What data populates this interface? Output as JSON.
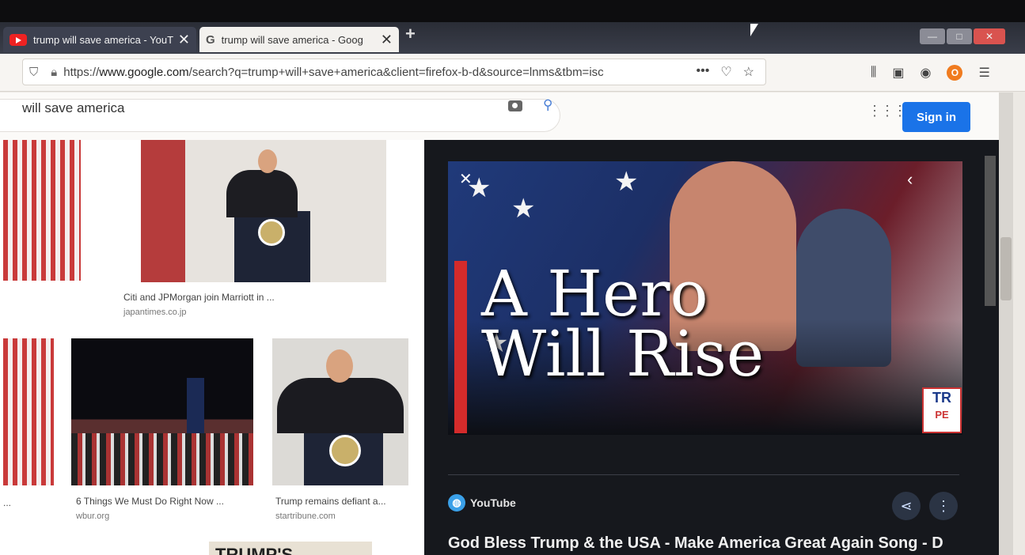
{
  "browser": {
    "tabs": [
      {
        "title": "trump will save america - YouT",
        "close": "✕"
      },
      {
        "title": "trump will save america - Goog",
        "close": "✕"
      }
    ],
    "new_tab": "+",
    "url_https": "https://",
    "url_domain": "www.google.com",
    "url_path": "/search?q=trump+will+save+america&client=firefox-b-d&source=lnms&tbm=isc",
    "page_actions": "•••",
    "window_controls": [
      "—",
      "□",
      "✕"
    ]
  },
  "google": {
    "query": "will save america",
    "sign_in": "Sign in"
  },
  "results": [
    {
      "caption": "Citi and JPMorgan join Marriott in ...",
      "source": "japantimes.co.jp"
    },
    {
      "caption": "6 Things We Must Do Right Now ...",
      "source": "wbur.org"
    },
    {
      "caption": "Trump remains defiant a...",
      "source": "startribune.com"
    },
    {
      "caption": "...",
      "source": ""
    },
    {
      "caption": "TRUMP'S",
      "source": ""
    }
  ],
  "panel": {
    "hero_line1": "A Hero",
    "hero_line2": "Will Rise",
    "badge_line1": "TR",
    "badge_line2": "PE",
    "source": "YouTube",
    "title": "God Bless Trump & the USA - Make America Great Again Song - D"
  },
  "colors": {
    "accent": "#1a73e8",
    "brand_red": "#d42b2b"
  }
}
